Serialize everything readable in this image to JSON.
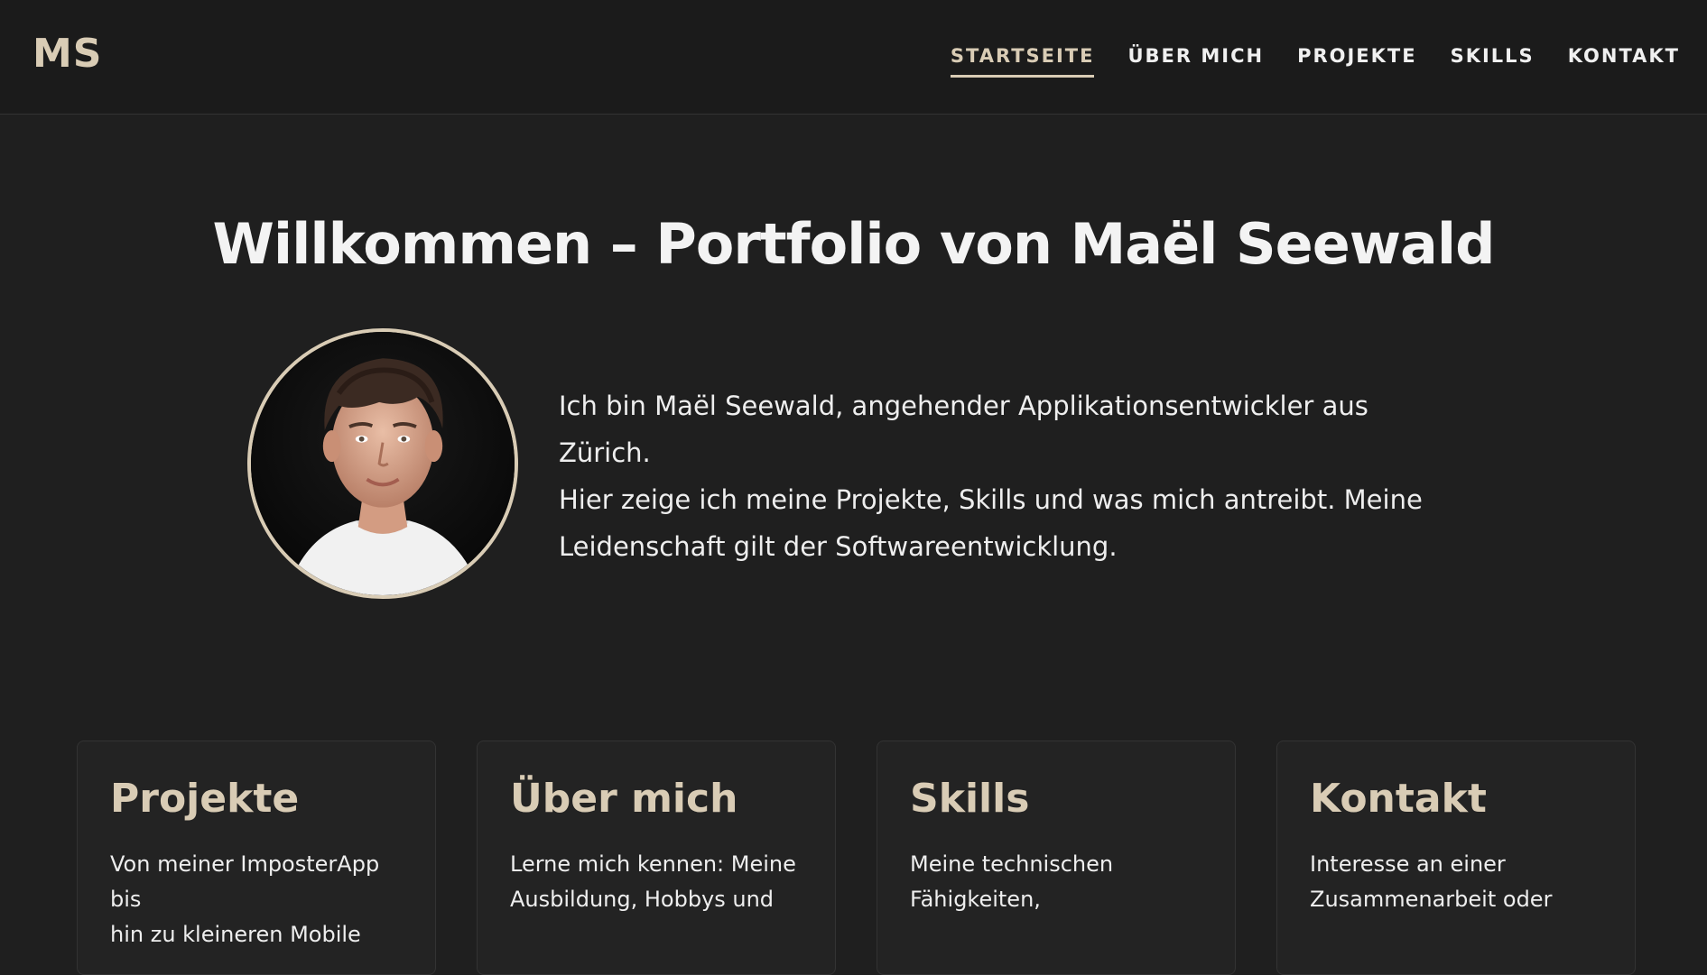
{
  "header": {
    "logo": "MS",
    "nav": [
      {
        "label": "STARTSEITE",
        "active": true
      },
      {
        "label": "ÜBER MICH",
        "active": false
      },
      {
        "label": "PROJEKTE",
        "active": false
      },
      {
        "label": "SKILLS",
        "active": false
      },
      {
        "label": "KONTAKT",
        "active": false
      }
    ]
  },
  "hero": {
    "title": "Willkommen – Portfolio von Maël Seewald",
    "intro_lines": [
      "Ich bin Maël Seewald, angehender Applikationsentwickler aus Zürich.",
      "Hier zeige ich meine Projekte, Skills und was mich antreibt. Meine",
      "Leidenschaft gilt der Softwareentwicklung."
    ]
  },
  "cards": [
    {
      "title": "Projekte",
      "text_lines": [
        "Von meiner ImposterApp bis",
        "hin zu kleineren Mobile"
      ]
    },
    {
      "title": "Über mich",
      "text_lines": [
        "Lerne mich kennen: Meine",
        "Ausbildung, Hobbys und"
      ]
    },
    {
      "title": "Skills",
      "text_lines": [
        "Meine technischen",
        "Fähigkeiten,"
      ]
    },
    {
      "title": "Kontakt",
      "text_lines": [
        "Interesse an einer",
        "Zusammenarbeit oder"
      ]
    }
  ],
  "colors": {
    "background": "#1f1f1f",
    "header_background": "#1b1b1b",
    "accent": "#d9ccb5",
    "card_background": "#232323",
    "text": "#f2f2f2"
  },
  "icons": {
    "profile_photo": "profile-photo"
  }
}
